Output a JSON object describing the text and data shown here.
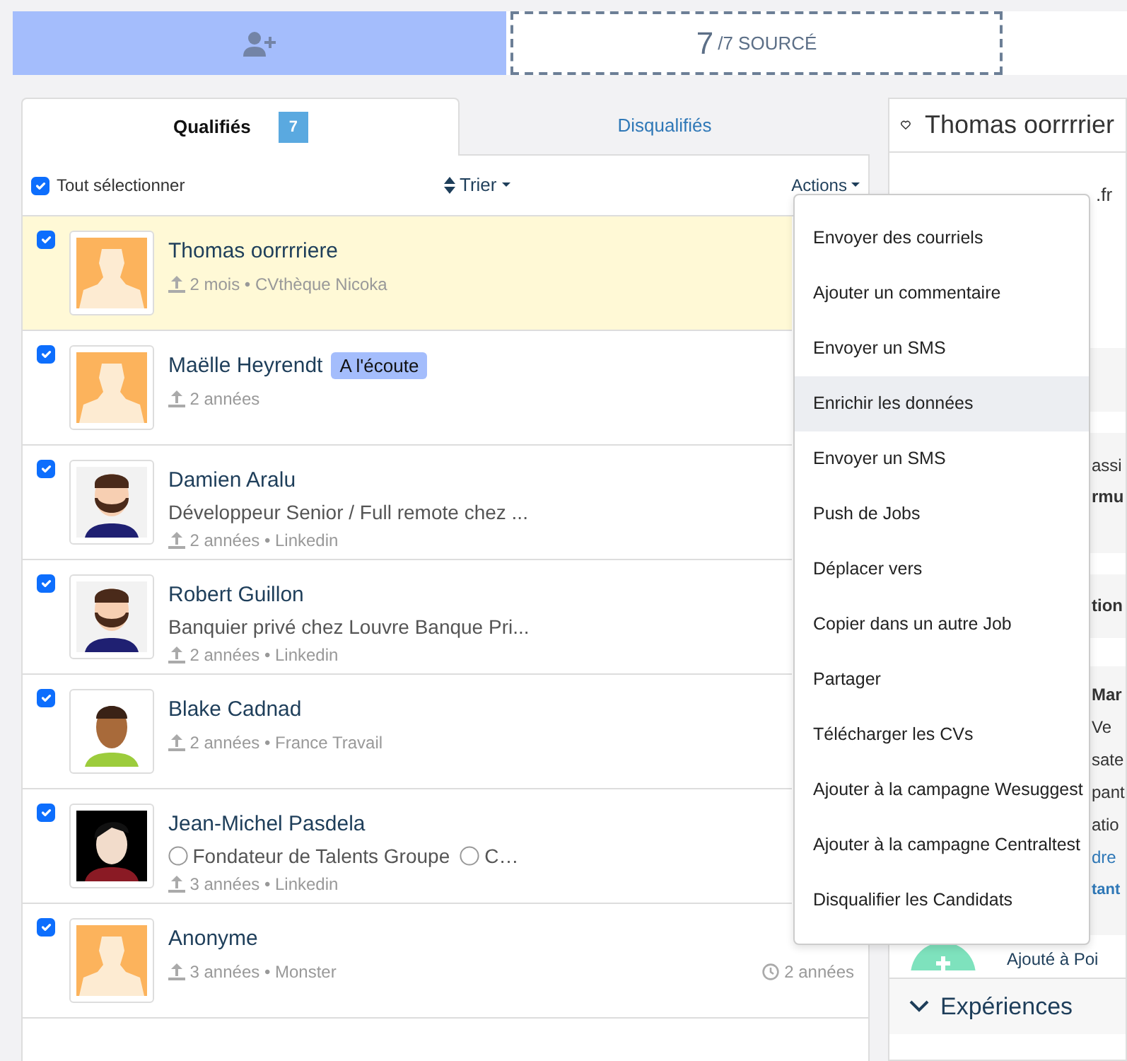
{
  "top_bar": {
    "count": "7",
    "total": "/7 SOURCÉ"
  },
  "tabs": [
    {
      "label": "Qualifiés",
      "badge": "7",
      "selected": true
    },
    {
      "label": "Disqualifiés",
      "selected": false
    }
  ],
  "toolbar": {
    "select_all": {
      "label": "Tout sélectionner",
      "checked": true
    },
    "sort": "Trier",
    "actions": "Actions"
  },
  "candidates": [
    {
      "name": "Thomas oorrrriere",
      "meta": "2 mois • CVthèque Nicoka",
      "checked": true,
      "highlighted": true
    },
    {
      "name": "Maëlle Heyrendt",
      "badge": "A l'écoute",
      "meta": "2 années",
      "checked": true,
      "highlighted": false
    },
    {
      "name": "Damien Aralu",
      "subtitle": "Développeur Senior / Full remote chez ...",
      "meta": "2 années • Linkedin",
      "checked": true,
      "highlighted": false
    },
    {
      "name": "Robert Guillon",
      "subtitle": "Banquier privé chez Louvre Banque Pri...",
      "meta": "2 années • Linkedin",
      "checked": true,
      "highlighted": false
    },
    {
      "name": "Blake Cadnad",
      "meta": "2 années • France Travail",
      "checked": true,
      "highlighted": false
    },
    {
      "name": "Jean-Michel Pasdela",
      "positions": [
        "Fondateur de Talents Groupe",
        "C…"
      ],
      "meta": "3 années • Linkedin",
      "checked": true,
      "highlighted": false
    },
    {
      "name": "Anonyme",
      "meta": "3 années • Monster",
      "time": "2 années",
      "checked": true,
      "highlighted": false
    }
  ],
  "actions_menu": [
    {
      "label": "Envoyer des courriels",
      "hovered": false
    },
    {
      "label": "Ajouter un commentaire",
      "hovered": false
    },
    {
      "label": "Envoyer un SMS",
      "hovered": false
    },
    {
      "label": "Enrichir les données",
      "hovered": true
    },
    {
      "label": "Envoyer un SMS",
      "hovered": false
    },
    {
      "label": "Push de Jobs",
      "hovered": false
    },
    {
      "label": "Déplacer vers",
      "hovered": false
    },
    {
      "label": "Copier dans un autre Job",
      "hovered": false
    },
    {
      "label": "Partager",
      "hovered": false
    },
    {
      "label": "Télécharger les CVs",
      "hovered": false
    },
    {
      "label": "Ajouter à la campagne Wesuggest",
      "hovered": false
    },
    {
      "label": "Ajouter à la campagne Centraltest",
      "hovered": false
    },
    {
      "label": "Disqualifier les Candidats",
      "hovered": false
    }
  ],
  "detail": {
    "title": "Thomas oorrrrier",
    "email_fragment": ".fr",
    "sections": [
      {
        "lines": [
          {
            "text": "assi",
            "kind": "plain"
          },
          {
            "text": "rmu",
            "kind": "bold"
          }
        ]
      },
      {
        "lines": [
          {
            "text": "tion",
            "kind": "bold"
          }
        ]
      },
      {
        "lines": [
          {
            "text": "Mar",
            "kind": "bold"
          },
          {
            "text": "Ve",
            "kind": "plain"
          },
          {
            "text": "sate",
            "kind": "plain"
          },
          {
            "text": "pant",
            "kind": "plain"
          },
          {
            "text": "atio",
            "kind": "plain"
          },
          {
            "text": "dre",
            "kind": "link"
          },
          {
            "text": "tant",
            "kind": "small"
          }
        ]
      }
    ],
    "activity": "Ajouté à Poi",
    "experiences": "Expériences"
  }
}
